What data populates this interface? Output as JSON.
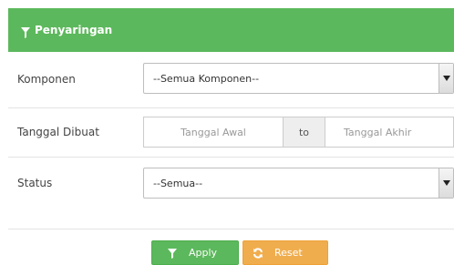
{
  "header": {
    "title": "Penyaringan",
    "icon": "funnel-icon"
  },
  "filters": {
    "komponen": {
      "label": "Komponen",
      "selected": "--Semua Komponen--"
    },
    "tanggal": {
      "label": "Tanggal Dibuat",
      "start_placeholder": "Tanggal Awal",
      "separator": "to",
      "end_placeholder": "Tanggal Akhir"
    },
    "status": {
      "label": "Status",
      "selected": "--Semua--"
    }
  },
  "buttons": {
    "apply": {
      "label": "Apply",
      "icon": "funnel-icon"
    },
    "reset": {
      "label": "Reset",
      "icon": "refresh-icon"
    }
  },
  "colors": {
    "header_bg": "#5cb85c",
    "apply_bg": "#5cb85c",
    "reset_bg": "#f0ad4e"
  }
}
